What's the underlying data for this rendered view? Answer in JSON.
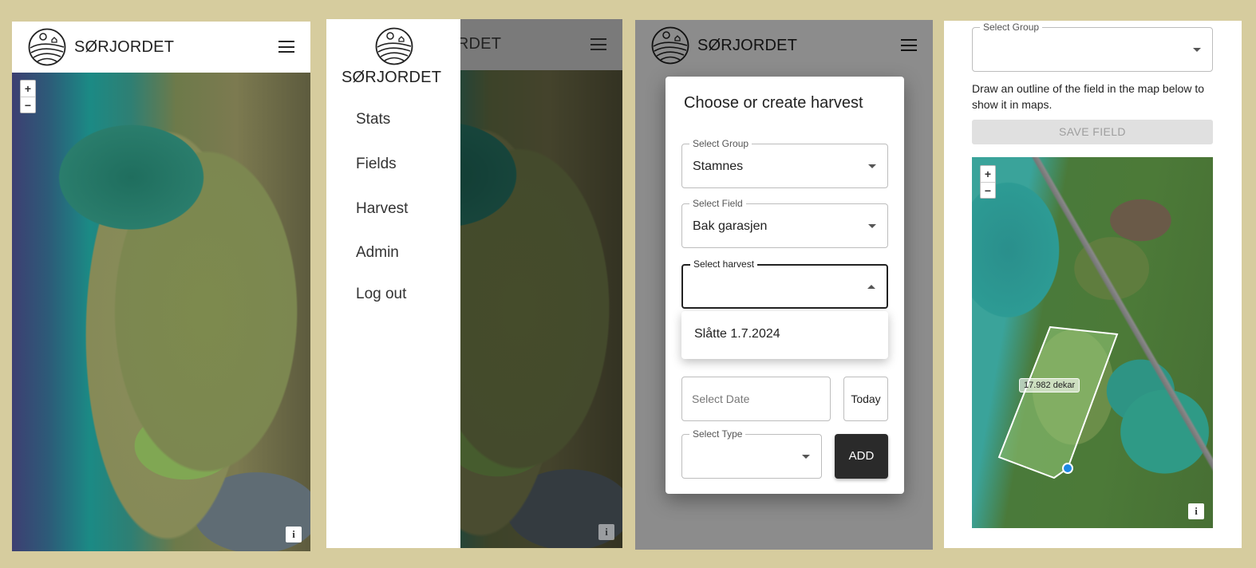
{
  "app": {
    "brand": "SØRJORDET",
    "logo_icon": "farm-logo-icon",
    "menu_icon": "hamburger-menu-icon"
  },
  "map": {
    "zoom_in": "+",
    "zoom_out": "−",
    "info": "i"
  },
  "drawer": {
    "items": [
      {
        "label": "Stats"
      },
      {
        "label": "Fields"
      },
      {
        "label": "Harvest"
      },
      {
        "label": "Admin"
      },
      {
        "label": "Log out"
      }
    ]
  },
  "harvest_dialog": {
    "title": "Choose or create harvest",
    "group": {
      "label": "Select Group",
      "value": "Stamnes"
    },
    "field": {
      "label": "Select Field",
      "value": "Bak garasjen"
    },
    "harvest": {
      "label": "Select harvest",
      "value": "",
      "options": [
        "Slåtte 1.7.2024"
      ]
    },
    "date": {
      "placeholder": "Select Date"
    },
    "today_label": "Today",
    "type": {
      "label": "Select Type",
      "value": ""
    },
    "add_label": "ADD"
  },
  "field_editor": {
    "group": {
      "label": "Select Group",
      "value": ""
    },
    "instructions": "Draw an outline of the field in the map below to show it in maps.",
    "save_label": "SAVE FIELD",
    "area_label": "17.982 dekar"
  },
  "colors": {
    "background": "#d6cc9e",
    "primary_dark": "#2a2a2a",
    "disabled": "#e0e0e0",
    "vertex_marker": "#1e88e5"
  }
}
